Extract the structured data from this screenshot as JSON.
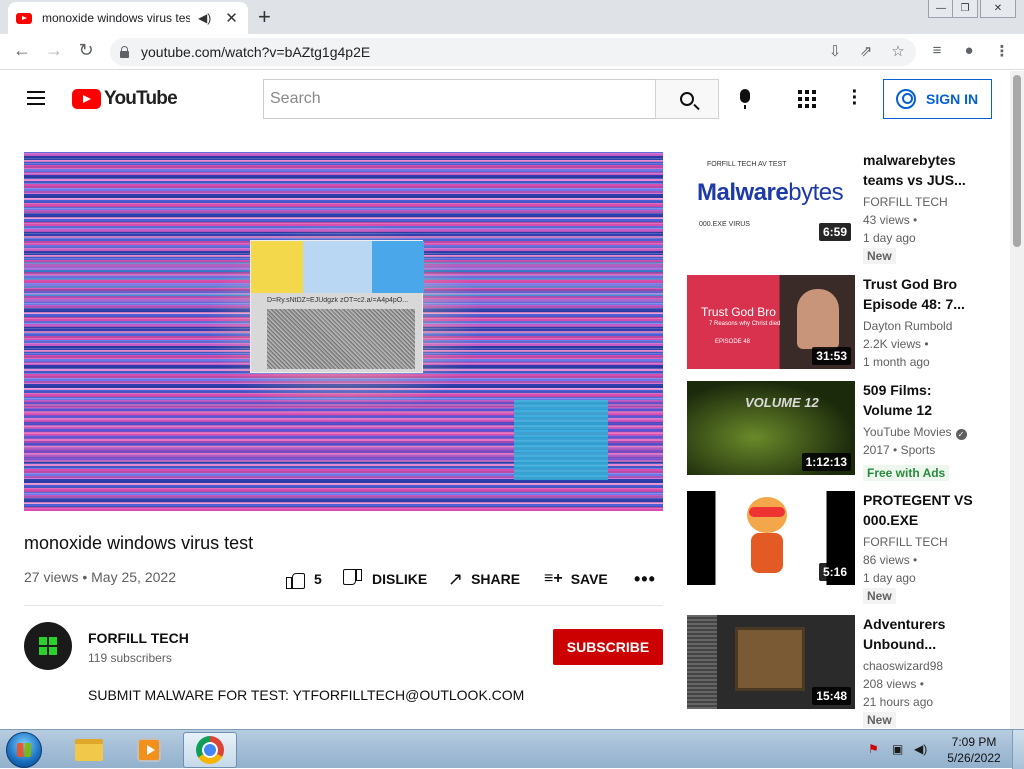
{
  "browser": {
    "tab_title": "monoxide windows virus test",
    "tab_close": "✕",
    "new_tab": "+",
    "url": "youtube.com/watch?v=bAZtg1g4p2E",
    "window_controls": [
      "—",
      "❐",
      "✕"
    ]
  },
  "header": {
    "logo_text": "YouTube",
    "search_placeholder": "Search",
    "signin_label": "SIGN IN"
  },
  "video": {
    "title": "monoxide windows virus test",
    "stats": "27 views • May 25, 2022",
    "player_overlay_text": "D=Ry.sNtDZ=EJUdgzk  zOT=c2.a/=A4p4pO...",
    "likes": "5",
    "dislike_label": "DISLIKE",
    "share_label": "SHARE",
    "save_label": "SAVE",
    "more_label": "•••"
  },
  "channel": {
    "name": "FORFILL TECH",
    "subscribers": "119 subscribers",
    "subscribe_label": "SUBSCRIBE",
    "description": "SUBMIT MALWARE FOR TEST: YTFORFILLTECH@OUTLOOK.COM"
  },
  "recommendations": [
    {
      "title": "malwarebytes teams vs JUS...",
      "channel": "FORFILL TECH",
      "views": "43 views •",
      "age": "1 day ago",
      "badge": "New",
      "duration": "6:59",
      "thumb_top_text": "FORFILL TECH AV TEST",
      "thumb_logo_a": "Malware",
      "thumb_logo_b": "bytes",
      "thumb_bottom_text": "000.EXE VIRUS"
    },
    {
      "title": "Trust God Bro Episode 48: 7...",
      "channel": "Dayton Rumbold",
      "views": "2.2K views •",
      "age": "1 month ago",
      "duration": "31:53",
      "thumb_title": "Trust God Bro",
      "thumb_sub": "7 Reasons why Christ died",
      "thumb_ep": "EPISODE 48"
    },
    {
      "title": "509 Films: Volume 12",
      "channel": "YouTube Movies",
      "views": "2017 • Sports",
      "badge": "Free with Ads",
      "duration": "1:12:13",
      "thumb_title": "VOLUME 12"
    },
    {
      "title": "PROTEGENT VS 000.EXE",
      "channel": "FORFILL TECH",
      "views": "86 views •",
      "age": "1 day ago",
      "badge": "New",
      "duration": "5:16"
    },
    {
      "title": "Adventurers Unbound...",
      "channel": "chaoswizard98",
      "views": "208 views •",
      "age": "21 hours ago",
      "badge": "New",
      "duration": "15:48"
    }
  ],
  "taskbar": {
    "time": "7:09 PM",
    "date": "5/26/2022"
  },
  "colors": {
    "youtube_red": "#ff0000",
    "subscribe_red": "#cc0000",
    "link_blue": "#065fd4"
  }
}
